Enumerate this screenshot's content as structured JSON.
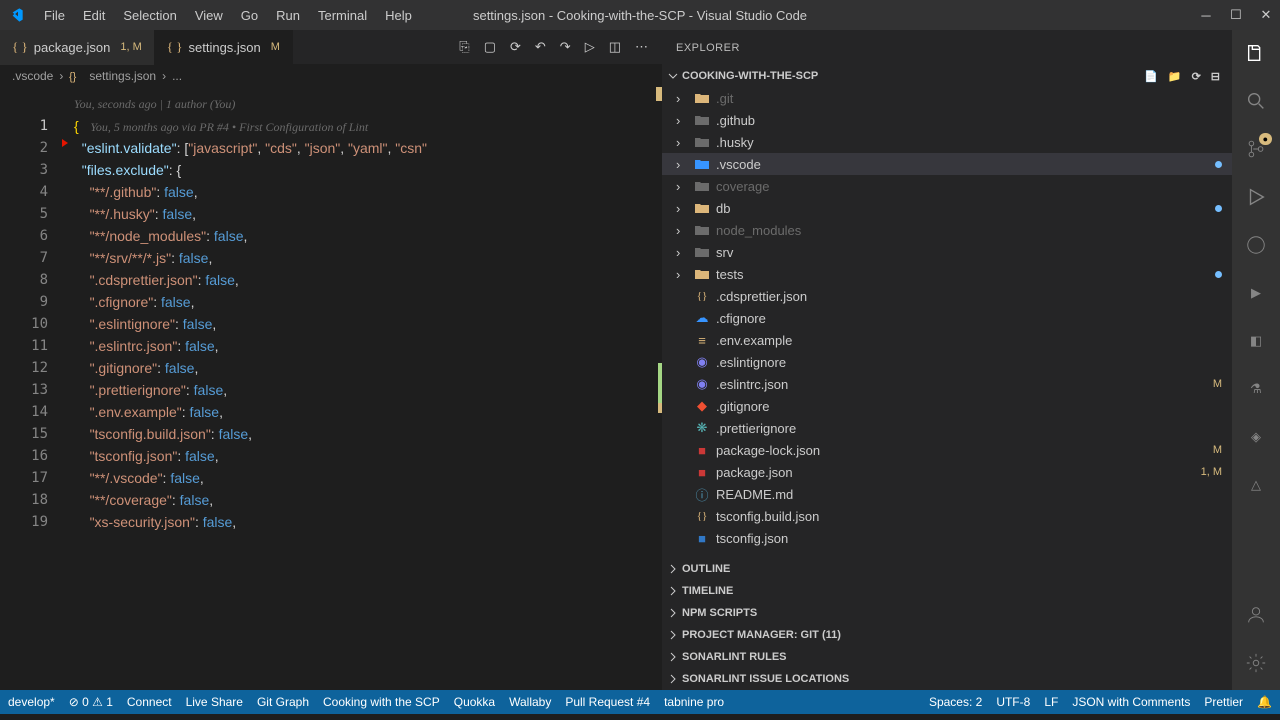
{
  "titlebar": {
    "menu": [
      "File",
      "Edit",
      "Selection",
      "View",
      "Go",
      "Run",
      "Terminal",
      "Help"
    ],
    "title": "settings.json - Cooking-with-the-SCP - Visual Studio Code"
  },
  "tabs": [
    {
      "icon": "json",
      "name": "package.json",
      "badge": "1, M"
    },
    {
      "icon": "json",
      "name": "settings.json",
      "badge": "M",
      "active": true
    }
  ],
  "breadcrumb": {
    "folder": ".vscode",
    "file": "settings.json",
    "rest": "..."
  },
  "blame_header": "You, seconds ago | 1 author (You)",
  "inline_blame": "You, 5 months ago via PR #4 • First Configuration of Lint",
  "lines": [
    {
      "n": 1,
      "html": "<span class='bracket'>{</span>   <span class='blame'>You, 5 months ago via PR #4 • First Configuration of Lint</span>"
    },
    {
      "n": 2,
      "html": "  <span class='key'>\"eslint.validate\"</span><span class='punct'>: [</span><span class='str'>\"javascript\"</span><span class='punct'>, </span><span class='str'>\"cds\"</span><span class='punct'>, </span><span class='str'>\"json\"</span><span class='punct'>, </span><span class='str'>\"yaml\"</span><span class='punct'>, </span><span class='str'>\"csn\"</span>"
    },
    {
      "n": 3,
      "html": "  <span class='key'>\"files.exclude\"</span><span class='punct'>: {</span>"
    },
    {
      "n": 4,
      "html": "    <span class='str'>\"**/.github\"</span><span class='punct'>: </span><span class='bool'>false</span><span class='punct'>,</span>"
    },
    {
      "n": 5,
      "html": "    <span class='str'>\"**/.husky\"</span><span class='punct'>: </span><span class='bool'>false</span><span class='punct'>,</span>"
    },
    {
      "n": 6,
      "html": "    <span class='str'>\"**/node_modules\"</span><span class='punct'>: </span><span class='bool'>false</span><span class='punct'>,</span>"
    },
    {
      "n": 7,
      "html": "    <span class='str'>\"**/srv/**/*.js\"</span><span class='punct'>: </span><span class='bool'>false</span><span class='punct'>,</span>"
    },
    {
      "n": 8,
      "html": "    <span class='str'>\".cdsprettier.json\"</span><span class='punct'>: </span><span class='bool'>false</span><span class='punct'>,</span>"
    },
    {
      "n": 9,
      "html": "    <span class='str'>\".cfignore\"</span><span class='punct'>: </span><span class='bool'>false</span><span class='punct'>,</span>"
    },
    {
      "n": 10,
      "html": "    <span class='str'>\".eslintignore\"</span><span class='punct'>: </span><span class='bool'>false</span><span class='punct'>,</span>"
    },
    {
      "n": 11,
      "html": "    <span class='str'>\".eslintrc.json\"</span><span class='punct'>: </span><span class='bool'>false</span><span class='punct'>,</span>"
    },
    {
      "n": 12,
      "html": "    <span class='str'>\".gitignore\"</span><span class='punct'>: </span><span class='bool'>false</span><span class='punct'>,</span>"
    },
    {
      "n": 13,
      "html": "    <span class='str'>\".prettierignore\"</span><span class='punct'>: </span><span class='bool'>false</span><span class='punct'>,</span>"
    },
    {
      "n": 14,
      "html": "    <span class='str'>\".env.example\"</span><span class='punct'>: </span><span class='bool'>false</span><span class='punct'>,</span>"
    },
    {
      "n": 15,
      "html": "    <span class='str'>\"tsconfig.build.json\"</span><span class='punct'>: </span><span class='bool'>false</span><span class='punct'>,</span>"
    },
    {
      "n": 16,
      "html": "    <span class='str'>\"tsconfig.json\"</span><span class='punct'>: </span><span class='bool'>false</span><span class='punct'>,</span>"
    },
    {
      "n": 17,
      "html": "    <span class='str'>\"**/.vscode\"</span><span class='punct'>: </span><span class='bool'>false</span><span class='punct'>,</span>"
    },
    {
      "n": 18,
      "html": "    <span class='str'>\"**/coverage\"</span><span class='punct'>: </span><span class='bool'>false</span><span class='punct'>,</span>"
    },
    {
      "n": 19,
      "html": "    <span class='str'>\"xs-security.json\"</span><span class='punct'>: </span><span class='bool'>false</span><span class='punct'>,</span>"
    }
  ],
  "explorer": {
    "title": "EXPLORER",
    "root": "COOKING-WITH-THE-SCP",
    "tree": [
      {
        "type": "folder",
        "name": ".git",
        "dim": true,
        "color": "#dcb67a"
      },
      {
        "type": "folder",
        "name": ".github",
        "color": "#6b6b6b"
      },
      {
        "type": "folder",
        "name": ".husky",
        "color": "#6b6b6b"
      },
      {
        "type": "folder",
        "name": ".vscode",
        "color": "#3794ff",
        "selected": true,
        "dot": true
      },
      {
        "type": "folder",
        "name": "coverage",
        "dim": true,
        "color": "#6b6b6b"
      },
      {
        "type": "folder",
        "name": "db",
        "color": "#dcb67a",
        "dot": true
      },
      {
        "type": "folder",
        "name": "node_modules",
        "dim": true,
        "color": "#6b6b6b"
      },
      {
        "type": "folder",
        "name": "srv",
        "color": "#6b6b6b"
      },
      {
        "type": "folder",
        "name": "tests",
        "color": "#dcb67a",
        "dot": true
      },
      {
        "type": "file",
        "name": ".cdsprettier.json",
        "icon": "json"
      },
      {
        "type": "file",
        "name": ".cfignore",
        "icon": "cf"
      },
      {
        "type": "file",
        "name": ".env.example",
        "icon": "env"
      },
      {
        "type": "file",
        "name": ".eslintignore",
        "icon": "eslint"
      },
      {
        "type": "file",
        "name": ".eslintrc.json",
        "icon": "eslint",
        "status": "M"
      },
      {
        "type": "file",
        "name": ".gitignore",
        "icon": "git"
      },
      {
        "type": "file",
        "name": ".prettierignore",
        "icon": "prettier"
      },
      {
        "type": "file",
        "name": "package-lock.json",
        "icon": "npm",
        "status": "M"
      },
      {
        "type": "file",
        "name": "package.json",
        "icon": "npm",
        "status": "1, M"
      },
      {
        "type": "file",
        "name": "README.md",
        "icon": "md"
      },
      {
        "type": "file",
        "name": "tsconfig.build.json",
        "icon": "json"
      },
      {
        "type": "file",
        "name": "tsconfig.json",
        "icon": "ts"
      }
    ],
    "sections": [
      "OUTLINE",
      "TIMELINE",
      "NPM SCRIPTS",
      "PROJECT MANAGER: GIT (11)",
      "SONARLINT RULES",
      "SONARLINT ISSUE LOCATIONS"
    ]
  },
  "statusbar": {
    "left": [
      "develop*",
      "⊘ 0 ⚠ 1",
      "Connect",
      "Live Share",
      "Git Graph",
      "Cooking with the SCP",
      "Quokka",
      "Wallaby",
      "Pull Request #4",
      "tabnine pro"
    ],
    "right": [
      "Spaces: 2",
      "UTF-8",
      "LF",
      "JSON with Comments",
      "Prettier"
    ]
  }
}
